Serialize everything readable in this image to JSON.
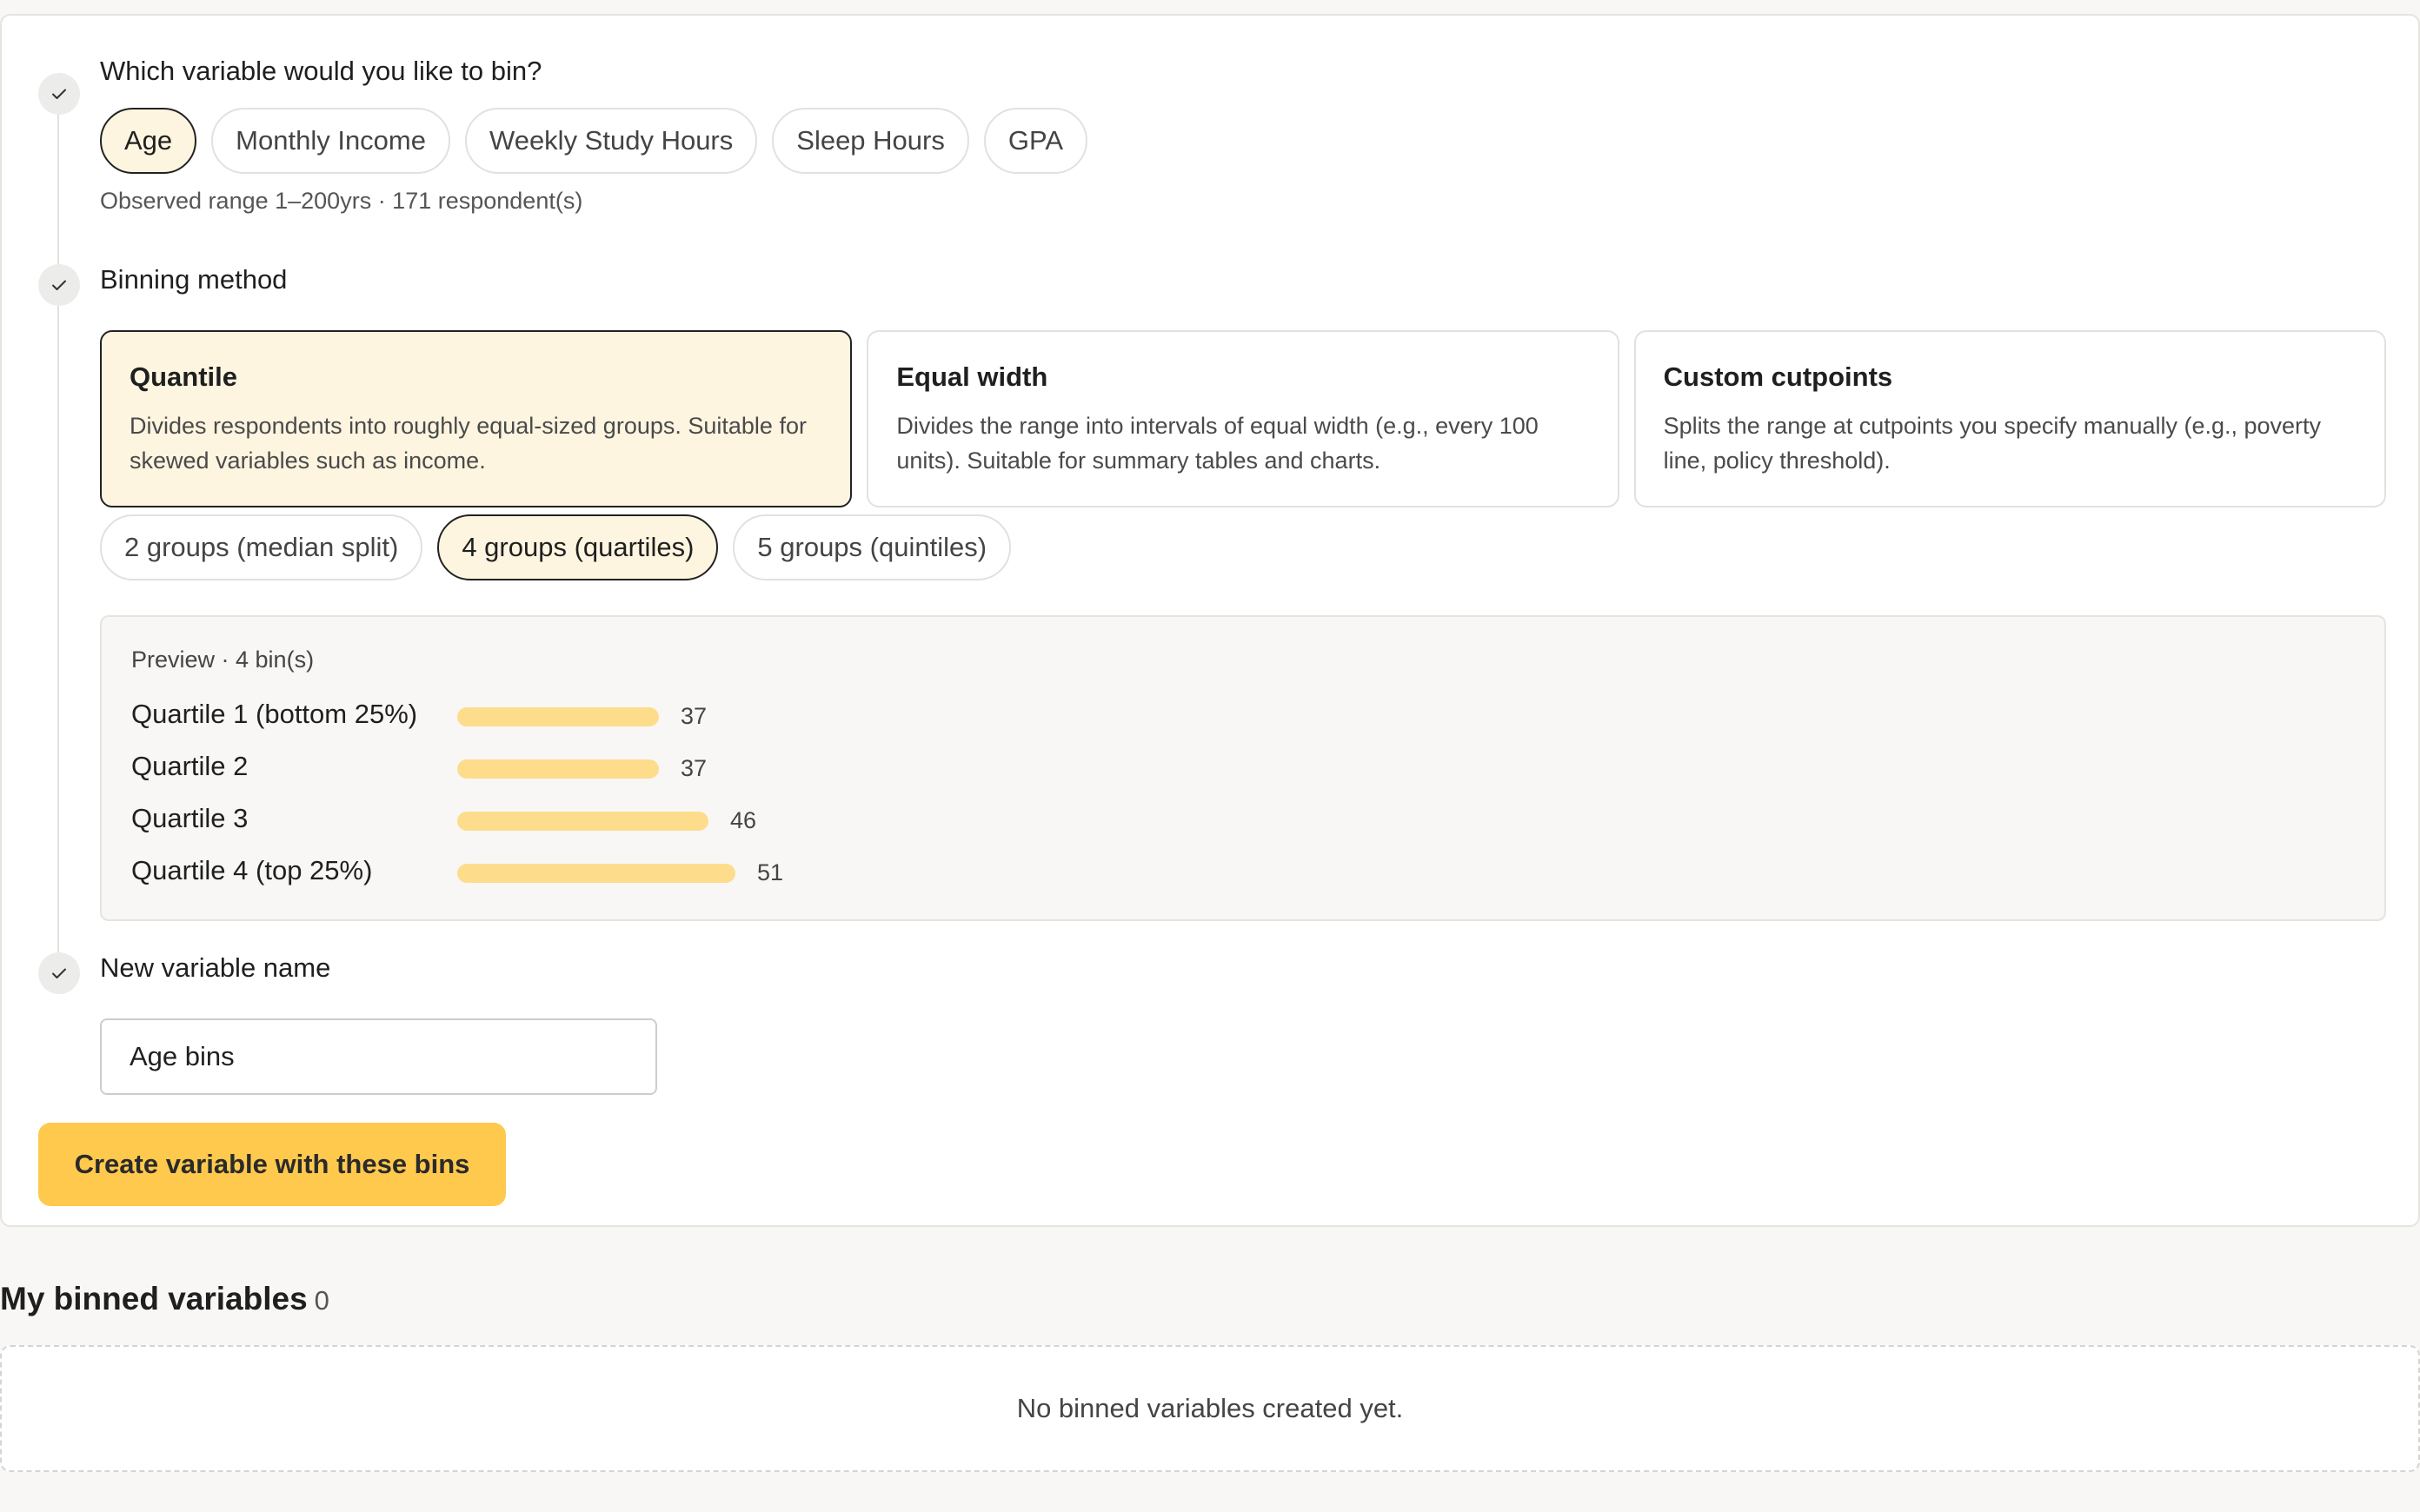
{
  "variable_step": {
    "title": "Which variable would you like to bin?",
    "options": [
      "Age",
      "Monthly Income",
      "Weekly Study Hours",
      "Sleep Hours",
      "GPA"
    ],
    "selected": "Age",
    "hint": "Observed range 1–200yrs · 171 respondent(s)"
  },
  "method_step": {
    "title": "Binning method",
    "methods": [
      {
        "title": "Quantile",
        "description": "Divides respondents into roughly equal-sized groups. Suitable for skewed variables such as income.",
        "selected": true
      },
      {
        "title": "Equal width",
        "description": "Divides the range into intervals of equal width (e.g., every 100 units). Suitable for summary tables and charts.",
        "selected": false
      },
      {
        "title": "Custom cutpoints",
        "description": "Splits the range at cutpoints you specify manually (e.g., poverty line, policy threshold).",
        "selected": false
      }
    ],
    "group_options": [
      "2 groups (median split)",
      "4 groups (quartiles)",
      "5 groups (quintiles)"
    ],
    "selected_group": "4 groups (quartiles)"
  },
  "preview": {
    "label": "Preview · 4 bin(s)",
    "bins": [
      {
        "name": "Quartile 1 (bottom 25%)",
        "count": 37
      },
      {
        "name": "Quartile 2",
        "count": 37
      },
      {
        "name": "Quartile 3",
        "count": 46
      },
      {
        "name": "Quartile 4 (top 25%)",
        "count": 51
      }
    ]
  },
  "name_step": {
    "title": "New variable name",
    "value": "Age bins"
  },
  "create_button": {
    "label": "Create variable with these bins"
  },
  "binned_section": {
    "title": "My binned variables",
    "count": "0",
    "empty_message": "No binned variables created yet."
  },
  "colors": {
    "accent": "#ffc94e",
    "selected_fill": "#fdf5e0",
    "bar_fill": "#fddc8c"
  },
  "icons": {
    "step_complete": "check-icon"
  }
}
